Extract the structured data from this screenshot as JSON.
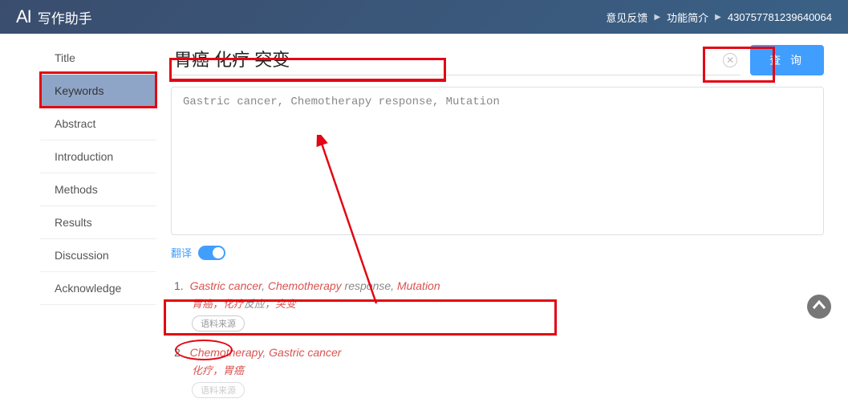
{
  "header": {
    "logo_en": "AI",
    "logo_cn": "写作助手",
    "links": {
      "feedback": "意见反馈",
      "features": "功能简介",
      "user_id": "430757781239640064"
    }
  },
  "sidebar": {
    "items": [
      {
        "label": "Title"
      },
      {
        "label": "Keywords",
        "active": true
      },
      {
        "label": "Abstract"
      },
      {
        "label": "Introduction"
      },
      {
        "label": "Methods"
      },
      {
        "label": "Results"
      },
      {
        "label": "Discussion"
      },
      {
        "label": "Acknowledge"
      }
    ]
  },
  "search": {
    "value": "胃癌 化疗 突变",
    "query_btn": "查 询"
  },
  "textarea": {
    "content": "Gastric cancer, Chemotherapy response, Mutation"
  },
  "translate": {
    "label": "翻译",
    "on": true
  },
  "results": [
    {
      "num": "1.",
      "en_parts": [
        {
          "text": "Gastric cancer",
          "hl": true
        },
        {
          "text": ", "
        },
        {
          "text": "Chemotherapy",
          "hl": true
        },
        {
          "text": " response, "
        },
        {
          "text": "Mutation",
          "hl": true
        }
      ],
      "cn_parts": [
        {
          "text": "胃癌，化疗",
          "hl": true
        },
        {
          "text": "反应，",
          "grey": true
        },
        {
          "text": "突变",
          "hl": true
        }
      ],
      "source_btn": "语料来源"
    },
    {
      "num": "2.",
      "en_parts": [
        {
          "text": "Chemotherapy",
          "hl": true
        },
        {
          "text": ", "
        },
        {
          "text": "Gastric cancer",
          "hl": true
        }
      ],
      "cn_parts": [
        {
          "text": "化疗，胃癌",
          "hl": true
        }
      ],
      "source_btn": "语料来源"
    }
  ]
}
